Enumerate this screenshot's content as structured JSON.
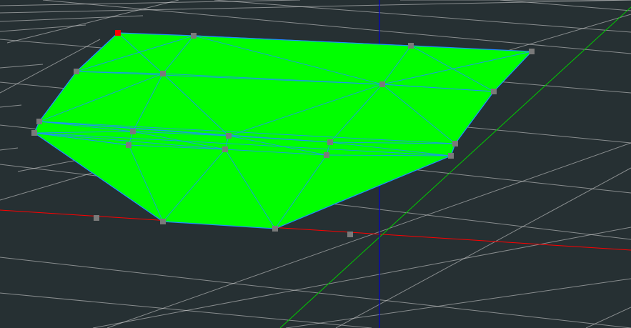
{
  "viewport": {
    "background": "#263033",
    "grid_color": "#d9d9d9",
    "mesh_fill": "#00ff00",
    "mesh_edge_color": "#1e90ff",
    "vertex_color": "#7a7a7a",
    "selected_vertex_color": "#ff0000",
    "axes": {
      "x_axis_color": "#ff0000",
      "y_axis_color": "#00cc00",
      "z_axis_color": "#0000cc"
    }
  },
  "mesh": {
    "name": "",
    "vertex_count": 18,
    "stray_vertex_count": 2,
    "selected_vertex_count": 1
  }
}
